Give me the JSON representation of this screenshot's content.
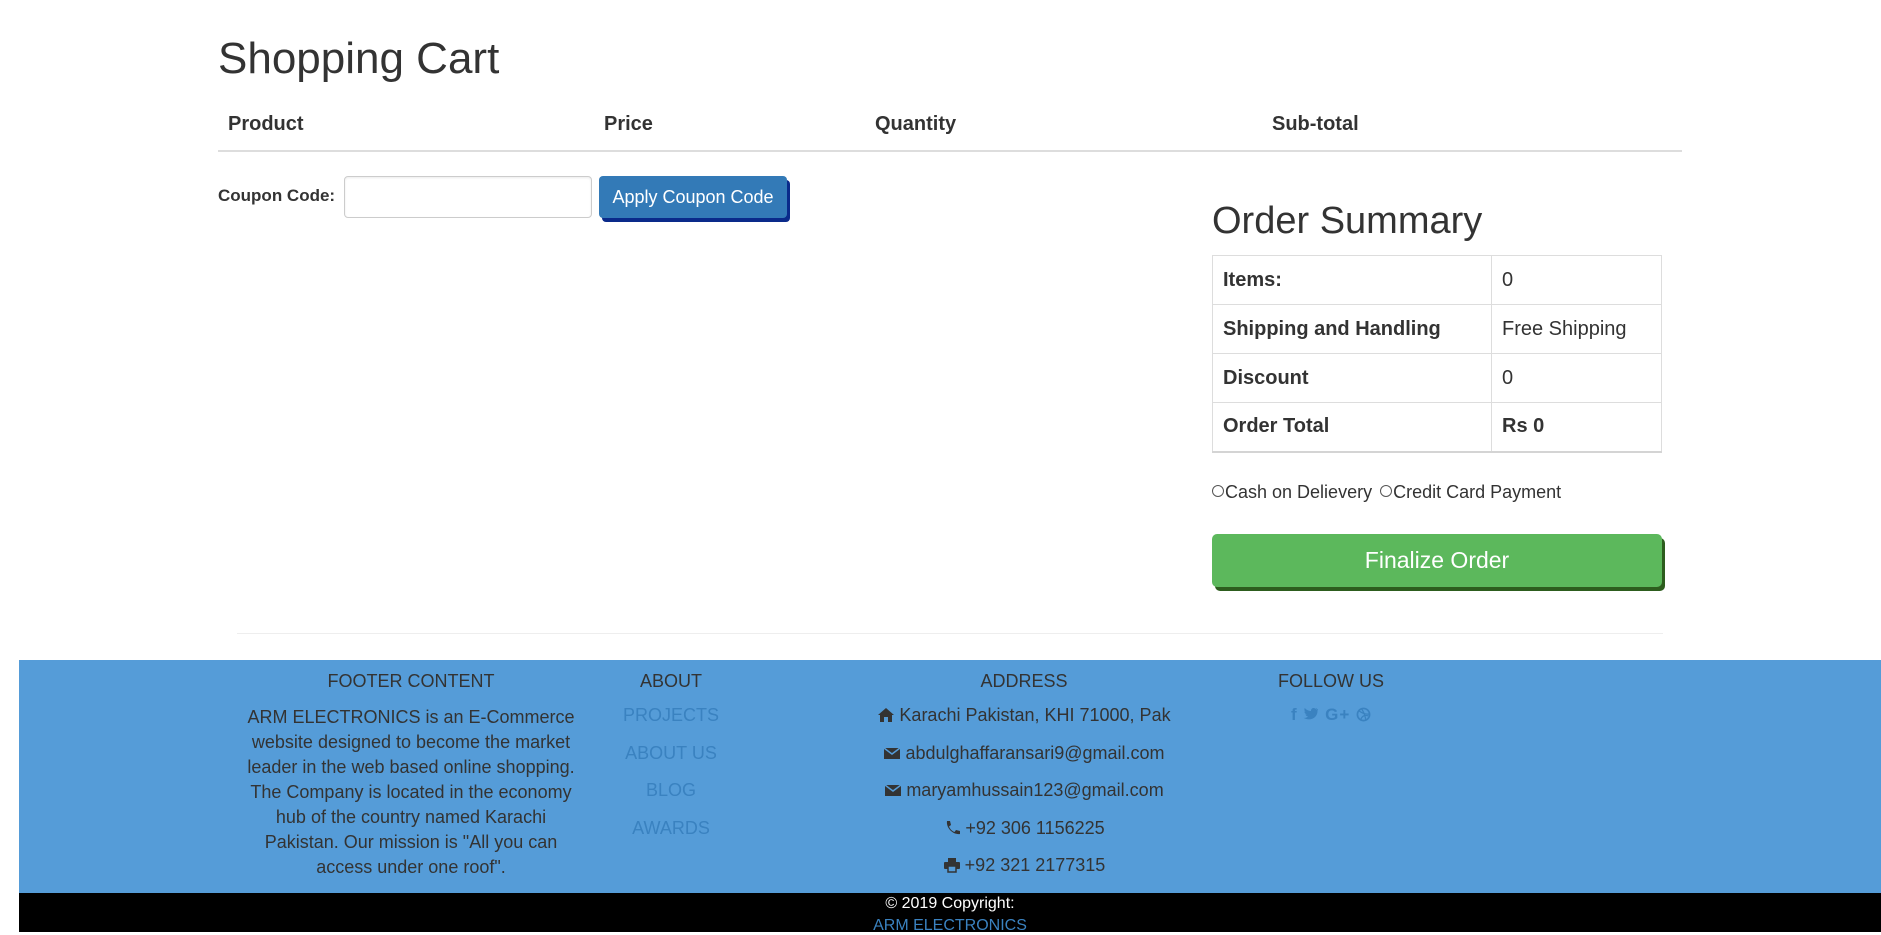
{
  "page": {
    "title": "Shopping Cart"
  },
  "cart": {
    "columns": {
      "product": "Product",
      "price": "Price",
      "quantity": "Quantity",
      "subtotal": "Sub-total"
    }
  },
  "coupon": {
    "label": "Coupon Code:",
    "value": "",
    "placeholder": "",
    "button_label": "Apply Coupon Code"
  },
  "summary": {
    "title": "Order Summary",
    "rows": [
      {
        "label": "Items:",
        "value": "0"
      },
      {
        "label": "Shipping and Handling",
        "value": "Free Shipping"
      },
      {
        "label": "Discount",
        "value": "0"
      },
      {
        "label": "Order Total",
        "value": "Rs 0"
      }
    ],
    "payment_options": [
      "Cash on Delievery",
      "Credit Card Payment"
    ],
    "finalize_label": "Finalize Order"
  },
  "footer": {
    "content_heading": "FOOTER CONTENT",
    "content_text": "ARM ELECTRONICS is an E-Commerce website designed to become the market leader in the web based online shopping. The Company is located in the economy hub of the country named Karachi Pakistan. Our mission is \"All you can access under one roof\".",
    "about_heading": "ABOUT",
    "about_links": [
      "PROJECTS",
      "ABOUT US",
      "BLOG",
      "AWARDS"
    ],
    "address_heading": "ADDRESS",
    "address_lines": [
      {
        "icon": "home-icon",
        "text": "Karachi Pakistan, KHI 71000, Pak"
      },
      {
        "icon": "envelope-icon",
        "text": "abdulghaffaransari9@gmail.com"
      },
      {
        "icon": "envelope-icon",
        "text": "maryamhussain123@gmail.com"
      },
      {
        "icon": "phone-icon",
        "text": "+92 306 1156225"
      },
      {
        "icon": "print-icon",
        "text": "+92 321 2177315"
      }
    ],
    "follow_heading": "FOLLOW US",
    "social_icons": [
      "facebook-icon",
      "twitter-icon",
      "google-plus-icon",
      "dribbble-icon"
    ],
    "copyright": "© 2019 Copyright:",
    "brand_link": "ARM ELECTRONICS"
  },
  "colors": {
    "primary_button": "#337ab7",
    "success_button": "#5cb85c",
    "footer_bg": "#559cd8",
    "bottom_bar": "#000000",
    "link": "#3a82c0"
  }
}
